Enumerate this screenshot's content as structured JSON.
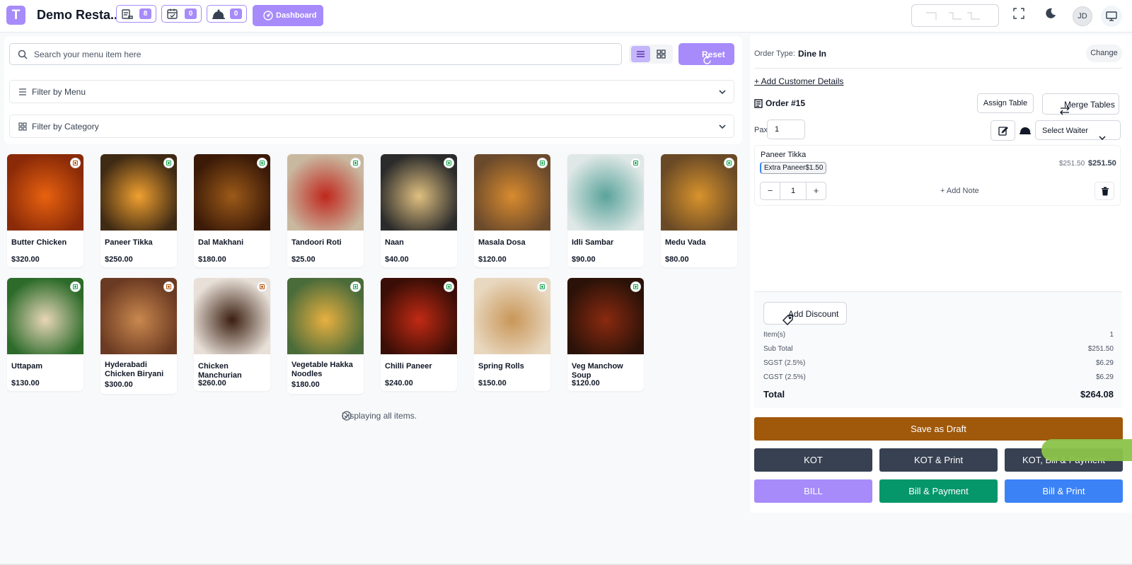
{
  "header": {
    "logo_letter": "T",
    "restaurant_name": "Demo Resta...",
    "badges": [
      {
        "icon": "orders-icon",
        "count": "8"
      },
      {
        "icon": "reservations-icon",
        "count": "0"
      },
      {
        "icon": "waiter-call-icon",
        "count": "0"
      }
    ],
    "dashboard_label": "Dashboard",
    "avatar_initials": "JD"
  },
  "search": {
    "placeholder": "Search your menu item here"
  },
  "reset_label": "Reset",
  "filters": {
    "menu": "Filter by Menu",
    "category": "Filter by Category"
  },
  "menu_items": [
    {
      "name": "Butter Chicken",
      "price": "$320.00",
      "veg": false
    },
    {
      "name": "Paneer Tikka",
      "price": "$250.00",
      "veg": true
    },
    {
      "name": "Dal Makhani",
      "price": "$180.00",
      "veg": true
    },
    {
      "name": "Tandoori Roti",
      "price": "$25.00",
      "veg": true
    },
    {
      "name": "Naan",
      "price": "$40.00",
      "veg": true
    },
    {
      "name": "Masala Dosa",
      "price": "$120.00",
      "veg": true
    },
    {
      "name": "Idli Sambar",
      "price": "$90.00",
      "veg": true
    },
    {
      "name": "Medu Vada",
      "price": "$80.00",
      "veg": true
    },
    {
      "name": "Uttapam",
      "price": "$130.00",
      "veg": true
    },
    {
      "name": "Hyderabadi Chicken Biryani",
      "price": "$300.00",
      "veg": false
    },
    {
      "name": "Chicken Manchurian",
      "price": "$260.00",
      "veg": false
    },
    {
      "name": "Vegetable Hakka Noodles",
      "price": "$180.00",
      "veg": true
    },
    {
      "name": "Chilli Paneer",
      "price": "$240.00",
      "veg": true
    },
    {
      "name": "Spring Rolls",
      "price": "$150.00",
      "veg": true
    },
    {
      "name": "Veg Manchow Soup",
      "price": "$120.00",
      "veg": true
    }
  ],
  "displaying_text": "Displaying all items.",
  "order": {
    "type_label": "Order Type:",
    "type_value": "Dine In",
    "change_label": "Change",
    "add_customer": "+ Add Customer Details",
    "order_number": "Order #15",
    "assign_table": "Assign Table",
    "merge_tables": "Merge Tables",
    "pax_label": "Pax",
    "pax_value": "1",
    "waiter_placeholder": "Select Waiter",
    "item": {
      "name": "Paneer Tikka",
      "modifier": "Extra Paneer",
      "modifier_price": "$1.50",
      "unit_price": "$251.50",
      "total": "$251.50",
      "quantity": "1",
      "add_note": "+ Add Note"
    }
  },
  "summary": {
    "add_discount": "Add Discount",
    "rows": [
      {
        "label": "Item(s)",
        "value": "1"
      },
      {
        "label": "Sub Total",
        "value": "$251.50"
      },
      {
        "label": "SGST (2.5%)",
        "value": "$6.29"
      },
      {
        "label": "CGST (2.5%)",
        "value": "$6.29"
      }
    ],
    "total_label": "Total",
    "total_value": "$264.08"
  },
  "actions": {
    "save_draft": "Save as Draft",
    "kot": "KOT",
    "kot_print": "KOT & Print",
    "kot_bill_payment": "KOT, Bill & Payment",
    "bill": "BILL",
    "bill_payment": "Bill & Payment",
    "bill_print": "Bill & Print"
  },
  "colors": {
    "accent": "#a78bfa",
    "draft": "#a0580a",
    "dark": "#374151",
    "green": "#059669",
    "blue": "#3b82f6",
    "veg": "#16a34a",
    "nonveg": "#b45309"
  }
}
